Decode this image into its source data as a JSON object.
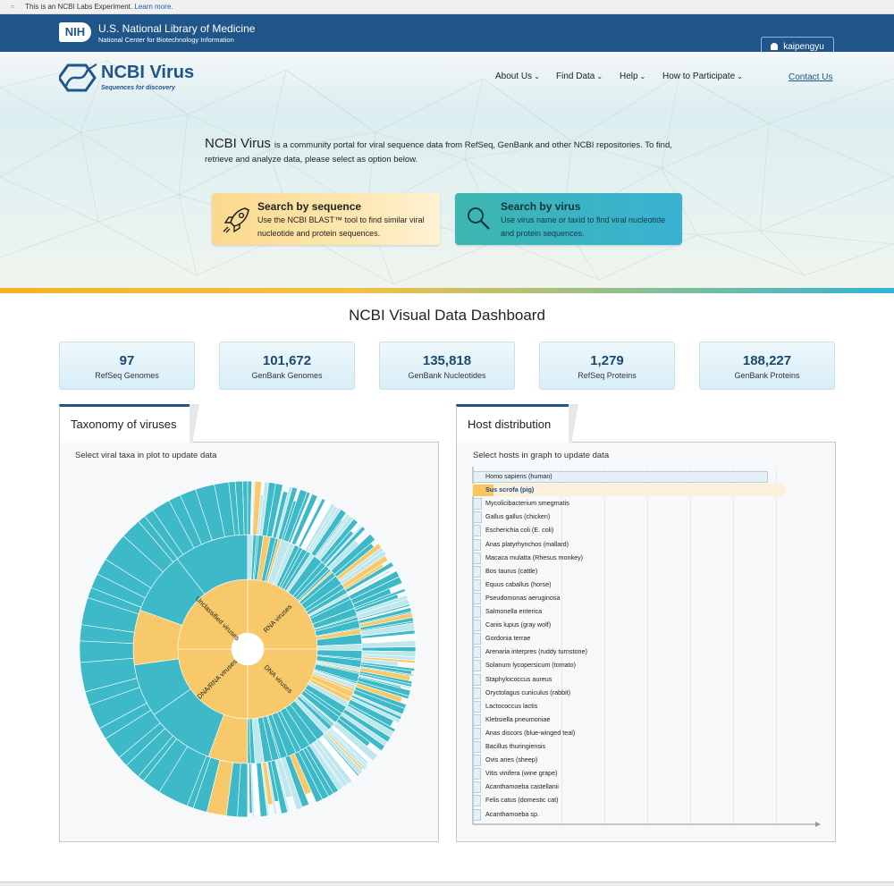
{
  "labs": {
    "text": "This is an NCBI Labs Experiment.",
    "link": "Learn more."
  },
  "nih": {
    "logo": "NIH",
    "title": "U.S. National Library of Medicine",
    "subtitle": "National Center for Biotechnology Information",
    "user": "kaipengyu"
  },
  "header": {
    "logo_text": "NCBI Virus",
    "logo_tag": "Sequences for discovery",
    "nav": [
      "About Us",
      "Find Data",
      "Help",
      "How to Participate"
    ],
    "contact": "Contact Us"
  },
  "intro": {
    "brand": "NCBI Virus",
    "text": "is a community portal for viral sequence data from RefSeq, GenBank and other NCBI repositories. To find, retrieve and analyze data, please select as option below."
  },
  "cards": {
    "sequence": {
      "title": "Search by sequence",
      "desc": "Use the NCBI BLAST™ tool to find similar viral nucleotide and protein sequences."
    },
    "virus": {
      "title": "Search by virus",
      "desc": "Use virus name or taxid to find viral nucleotide and protein sequences."
    }
  },
  "dashboard": {
    "title": "NCBI Visual Data Dashboard",
    "stats": [
      {
        "value": "97",
        "label": "RefSeq Genomes"
      },
      {
        "value": "101,672",
        "label": "GenBank Genomes"
      },
      {
        "value": "135,818",
        "label": "GenBank Nucleotides"
      },
      {
        "value": "1,279",
        "label": "RefSeq Proteins"
      },
      {
        "value": "188,227",
        "label": "GenBank Proteins"
      }
    ]
  },
  "taxonomy": {
    "tab": "Taxonomy of viruses",
    "hint": "Select viral taxa in plot to update data",
    "segments": [
      "RNA viruses",
      "DNA viruses",
      "DNA/RNA viruses",
      "Unclassified viruses"
    ],
    "colors": {
      "primary": "#3db9c8",
      "secondary": "#f8c96a",
      "light": "#bfe7ee"
    }
  },
  "hosts": {
    "tab": "Host distribution",
    "hint": "Select hosts in graph to update data",
    "selected": "Sus scrofa (pig)",
    "items": [
      {
        "name": "Homo sapiens (human)",
        "share": 1.0
      },
      {
        "name": "Sus scrofa (pig)",
        "share": 0.07
      },
      {
        "name": "Mycolicibacterium smegmatis",
        "share": 0.03
      },
      {
        "name": "Gallus gallus (chicken)",
        "share": 0.03
      },
      {
        "name": "Escherichia coli (E. coli)",
        "share": 0.02
      },
      {
        "name": "Anas platyrhynchos (mallard)",
        "share": 0.02
      },
      {
        "name": "Macaca mulatta (Rhesus monkey)",
        "share": 0.02
      },
      {
        "name": "Bos taurus (cattle)",
        "share": 0.02
      },
      {
        "name": "Equus caballus (horse)",
        "share": 0.01
      },
      {
        "name": "Pseudomonas aeruginosa",
        "share": 0.01
      },
      {
        "name": "Salmonella enterica",
        "share": 0.01
      },
      {
        "name": "Canis lupus (gray wolf)",
        "share": 0.01
      },
      {
        "name": "Gordonia terrae",
        "share": 0.01
      },
      {
        "name": "Arenaria interpres (ruddy turnstone)",
        "share": 0.01
      },
      {
        "name": "Solanum lycopersicum (tomato)",
        "share": 0.01
      },
      {
        "name": "Staphylococcus aureus",
        "share": 0.01
      },
      {
        "name": "Oryctolagus cuniculus (rabbit)",
        "share": 0.01
      },
      {
        "name": "Lactococcus lactis",
        "share": 0.01
      },
      {
        "name": "Klebsiella pneumoniae",
        "share": 0.01
      },
      {
        "name": "Anas discors (blue-winged teal)",
        "share": 0.01
      },
      {
        "name": "Bacillus thuringiensis",
        "share": 0.01
      },
      {
        "name": "Ovis aries (sheep)",
        "share": 0.01
      },
      {
        "name": "Vitis vinifera (wine grape)",
        "share": 0.01
      },
      {
        "name": "Acanthamoeba castellanii",
        "share": 0.01
      },
      {
        "name": "Felis catus (domestic cat)",
        "share": 0.01
      },
      {
        "name": "Acanthamoeba sp.",
        "share": 0.01
      }
    ]
  }
}
